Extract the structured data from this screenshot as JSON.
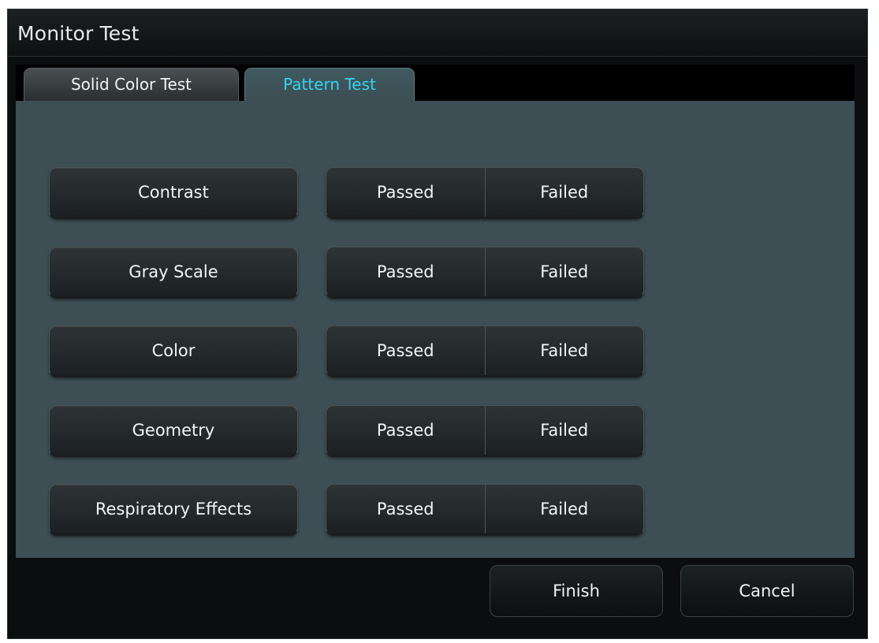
{
  "window": {
    "title": "Monitor Test"
  },
  "tabs": [
    {
      "label": "Solid Color Test",
      "active": false
    },
    {
      "label": "Pattern Test",
      "active": true
    }
  ],
  "tests": [
    {
      "label": "Contrast",
      "passed_label": "Passed",
      "failed_label": "Failed"
    },
    {
      "label": "Gray Scale",
      "passed_label": "Passed",
      "failed_label": "Failed"
    },
    {
      "label": "Color",
      "passed_label": "Passed",
      "failed_label": "Failed"
    },
    {
      "label": "Geometry",
      "passed_label": "Passed",
      "failed_label": "Failed"
    },
    {
      "label": "Respiratory Effects",
      "passed_label": "Passed",
      "failed_label": "Failed"
    }
  ],
  "footer": {
    "finish_label": "Finish",
    "cancel_label": "Cancel"
  },
  "colors": {
    "active_tab_text": "#35d4f0",
    "panel_background": "#3d4e54",
    "window_background": "#0b0d0e"
  }
}
